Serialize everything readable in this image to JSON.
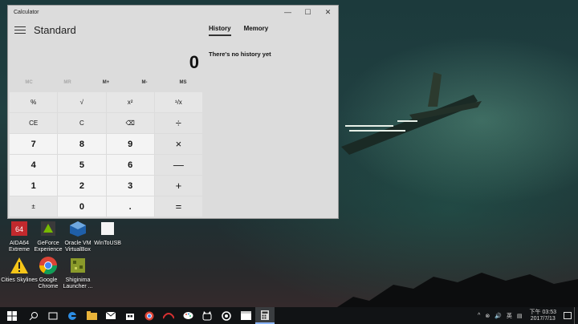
{
  "window": {
    "title": "Calculator",
    "minimize": "—",
    "maximize": "☐",
    "close": "✕"
  },
  "calculator": {
    "mode": "Standard",
    "display": "0",
    "memory_buttons": [
      "MC",
      "MR",
      "M+",
      "M-",
      "MS"
    ],
    "keys": [
      [
        "%",
        "√",
        "x²",
        "¹/x"
      ],
      [
        "CE",
        "C",
        "⌫",
        "÷"
      ],
      [
        "7",
        "8",
        "9",
        "×"
      ],
      [
        "4",
        "5",
        "6",
        "—"
      ],
      [
        "1",
        "2",
        "3",
        "+"
      ],
      [
        "±",
        "0",
        ".",
        "="
      ]
    ]
  },
  "history_panel": {
    "tabs": [
      "History",
      "Memory"
    ],
    "active_tab": "History",
    "empty_message": "There's no history yet"
  },
  "desktop_icons": [
    {
      "label": "AIDA64 Extreme",
      "icon": "aida64-icon"
    },
    {
      "label": "GeForce Experience",
      "icon": "geforce-icon"
    },
    {
      "label": "Oracle VM VirtualBox",
      "icon": "virtualbox-icon"
    },
    {
      "label": "WinToUSB",
      "icon": "wintousb-icon"
    },
    {
      "label": "Cities Skylines",
      "icon": "cities-skylines-icon"
    },
    {
      "label": "Google Chrome",
      "icon": "chrome-icon"
    },
    {
      "label": "Shiginima Launcher ...",
      "icon": "minecraft-launcher-icon"
    }
  ],
  "taskbar": {
    "clock_period": "下午 03:53",
    "date": "2017/7/13",
    "tray_symbols": [
      "^",
      "⊗",
      "🔊",
      "英",
      "▤"
    ]
  }
}
